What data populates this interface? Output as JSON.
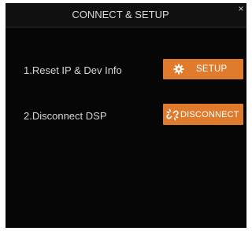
{
  "window": {
    "title": "CONNECT & SETUP",
    "close_symbol": "×"
  },
  "rows": [
    {
      "label": "1.Reset IP & Dev Info",
      "button_label": "SETUP",
      "button_icon": "gear-icon"
    },
    {
      "label": "2.Disconnect DSP",
      "button_label": "DISCONNECT",
      "button_icon": "broken-link-icon"
    }
  ],
  "colors": {
    "background": "#060606",
    "button": "#e07b2e",
    "button_text": "#ffffff",
    "label_text": "#d6d6d6"
  }
}
